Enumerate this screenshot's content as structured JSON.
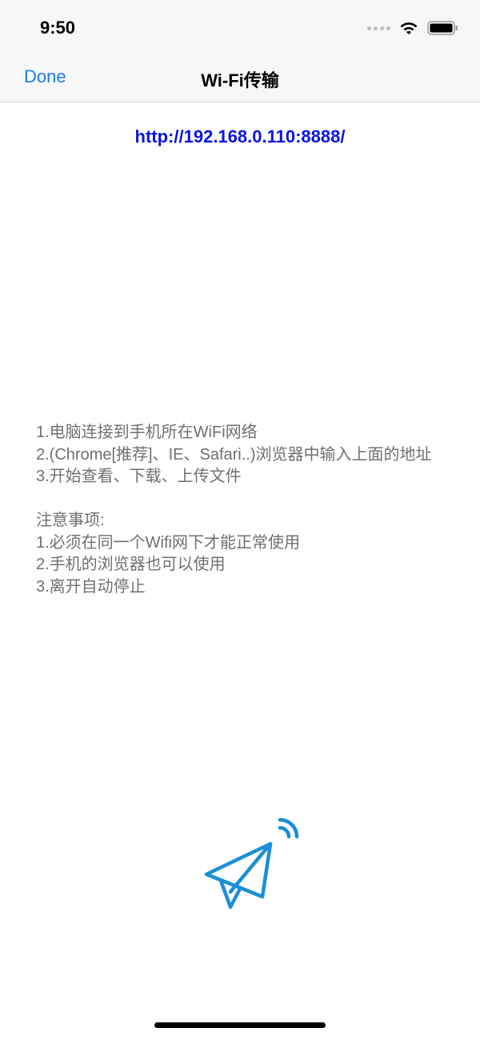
{
  "status_bar": {
    "time": "9:50",
    "icons": [
      "signal-icon",
      "wifi-icon",
      "battery-icon"
    ]
  },
  "nav": {
    "done_label": "Done",
    "title": "Wi-Fi传输"
  },
  "url": "http://192.168.0.110:8888/",
  "instructions": {
    "steps": [
      "1.电脑连接到手机所在WiFi网络",
      "2.(Chrome[推荐]、IE、Safari..)浏览器中输入上面的地址",
      "3.开始查看、下载、上传文件"
    ],
    "notes_title": "注意事项:",
    "notes": [
      "1.必须在同一个Wifi网下才能正常使用",
      "2.手机的浏览器也可以使用",
      "3.离开自动停止"
    ]
  },
  "colors": {
    "accent": "#1e7ce6",
    "link": "#0a14e6",
    "text_gray": "#707070",
    "icon_blue": "#1a8fd8"
  },
  "illustration_icon": "paper-plane-wifi-icon"
}
